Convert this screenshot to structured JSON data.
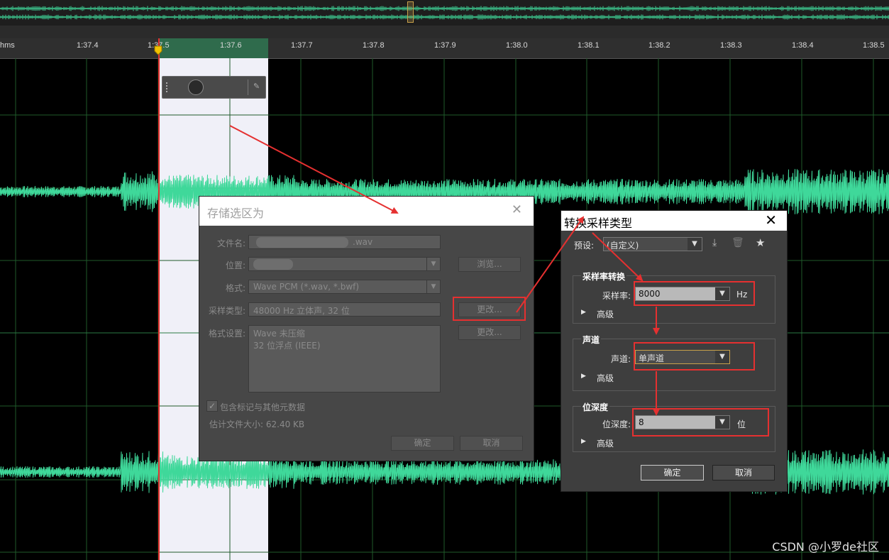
{
  "timeline": {
    "units_label": "hms",
    "ticks": [
      "1:37.4",
      "1:37.5",
      "1:37.6",
      "1:37.7",
      "1:37.8",
      "1:37.9",
      "1:38.0",
      "1:38.1",
      "1:38.2",
      "1:38.3",
      "1:38.4",
      "1:38.5"
    ]
  },
  "save_dialog": {
    "title": "存储选区为",
    "close": "✕",
    "filename_label": "文件名:",
    "filename_value": ".wav",
    "location_label": "位置:",
    "location_value": "",
    "browse_label": "浏览...",
    "format_label": "格式:",
    "format_value": "Wave PCM (*.wav, *.bwf)",
    "sample_type_label": "采样类型:",
    "sample_type_value": "48000 Hz 立体声, 32 位",
    "change1_label": "更改...",
    "format_settings_label": "格式设置:",
    "format_settings_line1": "Wave 未压缩",
    "format_settings_line2": "32 位浮点 (IEEE)",
    "change2_label": "更改...",
    "include_markers_label": "包含标记与其他元数据",
    "est_size_label": "估计文件大小: 62.40 KB",
    "ok_label": "确定",
    "cancel_label": "取消"
  },
  "convert_dialog": {
    "title": "转换采样类型",
    "close": "✕",
    "preset_label": "预设:",
    "preset_value": "(自定义)",
    "group_rate_title": "采样率转换",
    "rate_label": "采样率:",
    "rate_value": "8000",
    "rate_unit": "Hz",
    "advanced_label": "高级",
    "group_channel_title": "声道",
    "channel_label": "声道:",
    "channel_value": "单声道",
    "group_depth_title": "位深度",
    "depth_label": "位深度:",
    "depth_value": "8",
    "depth_unit": "位",
    "ok_label": "确定",
    "cancel_label": "取消"
  },
  "watermark": "CSDN @小罗de社区",
  "colors": {
    "waveform": "#3fd89a",
    "selection": "#f0f0f8",
    "playhead": "#e53030",
    "annotation": "#e53030",
    "grid": "#1f5a2a"
  }
}
